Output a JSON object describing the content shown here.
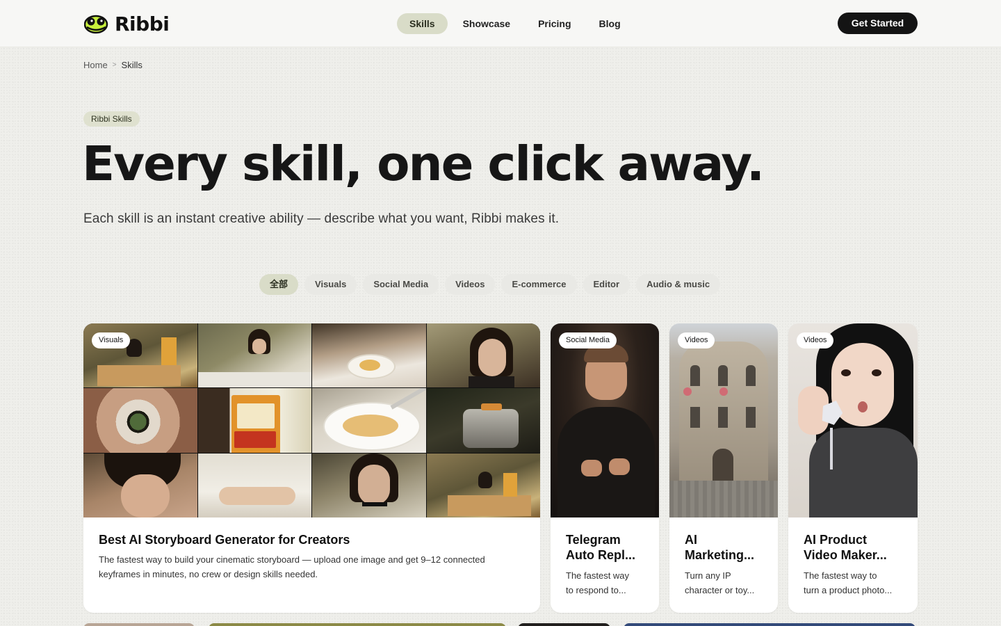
{
  "brand": {
    "name": "Ribbi"
  },
  "nav": {
    "items": [
      {
        "label": "Skills",
        "active": true
      },
      {
        "label": "Showcase"
      },
      {
        "label": "Pricing"
      },
      {
        "label": "Blog"
      }
    ],
    "cta": "Get Started"
  },
  "breadcrumb": {
    "home": "Home",
    "current": "Skills"
  },
  "hero": {
    "badge": "Ribbi Skills",
    "title": "Every skill, one click away.",
    "subtitle": "Each skill is an instant creative ability — describe what you want, Ribbi makes it."
  },
  "filters": [
    "全部",
    "Visuals",
    "Social Media",
    "Videos",
    "E-commerce",
    "Editor",
    "Audio & music"
  ],
  "cards": [
    {
      "tag": "Visuals",
      "title": "Best AI Storyboard Generator for Creators",
      "description_line1": "The fastest way to build your cinematic storyboard — upload one image and get 9–12 connected",
      "description_line2": "keyframes in minutes, no crew or design skills needed.",
      "image": "storyboard-grid"
    },
    {
      "tag": "Social Media",
      "title_line1": "Telegram",
      "title_line2": "Auto Repl...",
      "description_line1": "The fastest way",
      "description_line2": "to respond to...",
      "image": "man-gesturing-dark-sweater"
    },
    {
      "tag": "Videos",
      "title_line1": "AI",
      "title_line2": "Marketing...",
      "description_line1": "Turn any IP",
      "description_line2": "character or toy...",
      "image": "ornate-building-facade"
    },
    {
      "tag": "Videos",
      "title_line1": "AI Product",
      "title_line2": "Video Maker...",
      "description_line1": "The fastest way to",
      "description_line2": "turn a product photo...",
      "image": "woman-holding-pendant"
    }
  ],
  "colors": {
    "accent": "#d9dcc8",
    "cta": "#141414",
    "background": "#efefeb"
  }
}
